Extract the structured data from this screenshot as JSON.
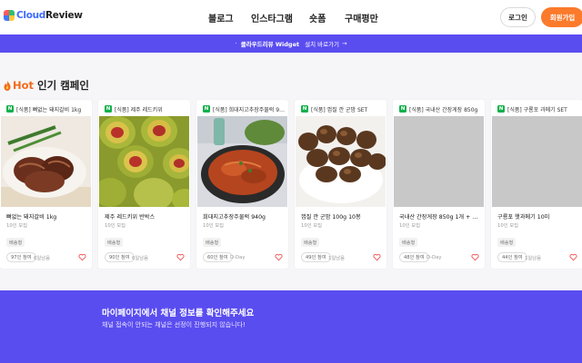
{
  "brand": {
    "logo_part1": "Cloud",
    "logo_part2": "Review",
    "colors": {
      "primary": "#5a4df0",
      "accent_orange": "#fb7a2b",
      "naver_green": "#10b04b"
    }
  },
  "nav": {
    "items": [
      "블로그",
      "인스타그램",
      "숏폼",
      "구매평만"
    ]
  },
  "auth": {
    "login_label": "로그인",
    "join_label": "회원가입"
  },
  "banner": {
    "bullet": "·",
    "title": "클라우드리뷰 Widget",
    "link": "설치 바로가기",
    "arrow": "→"
  },
  "section": {
    "hot": "Hot",
    "title": "인기 캠페인",
    "icon": "fire-icon"
  },
  "campaigns": [
    {
      "platform": "N",
      "tag": "[식품] 뼈없는 돼지갈비 1kg",
      "name": "뼈없는 돼지갈비 1kg",
      "recruit": "10인 모집",
      "type": "배송형",
      "apply": "97인 참여",
      "dday": "6일남음"
    },
    {
      "platform": "N",
      "tag": "[식품] 제주 레드키위",
      "name": "제주 레드키위 반박스",
      "recruit": "10인 모집",
      "type": "배송형",
      "apply": "90인 참여",
      "dday": "6일남음"
    },
    {
      "platform": "N",
      "tag": "[식품] 희대지고추장주물럭 940g",
      "name": "희대지고추장주물럭 940g",
      "recruit": "10인 모집",
      "type": "배송형",
      "apply": "60인 참여",
      "dday": "D-Day"
    },
    {
      "platform": "N",
      "tag": "[식품] 껍질 깐 군밤 SET",
      "name": "껍질 깐 군밤 100g 10봉",
      "recruit": "10인 모집",
      "type": "배송형",
      "apply": "49인 참여",
      "dday": "1일남음"
    },
    {
      "platform": "N",
      "tag": "[식품] 국내산 간장게장 850g",
      "name": "국내산 간장게장 850g 1개 + 서비스",
      "recruit": "10인 모집",
      "type": "배송형",
      "apply": "48인 참여",
      "dday": "D-Day"
    },
    {
      "platform": "N",
      "tag": "[식품] 구룡포 과메기 SET",
      "name": "구룡포 햇과메기 10미",
      "recruit": "10인 모집",
      "type": "배송형",
      "apply": "44인 참여",
      "dday": "1일남음"
    }
  ],
  "bottom": {
    "title": "마이페이지에서 채널 정보를 확인해주세요",
    "subtitle": "채널 접속이 안되는 채널은 선정이 진행되지 않습니다!"
  }
}
